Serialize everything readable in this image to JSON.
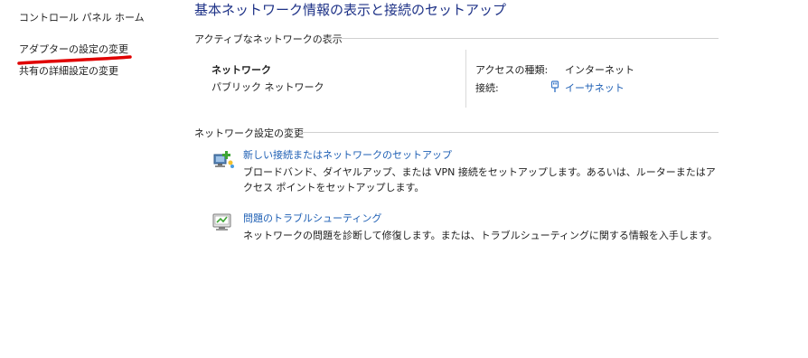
{
  "sidebar": {
    "items": [
      {
        "label": "コントロール パネル ホーム"
      },
      {
        "label": "アダプターの設定の変更"
      },
      {
        "label": "共有の詳細設定の変更"
      }
    ],
    "highlight_color": "#e00000"
  },
  "main": {
    "title": "基本ネットワーク情報の表示と接続のセットアップ",
    "active_networks": {
      "section_label": "アクティブなネットワークの表示",
      "network_name": "ネットワーク",
      "network_type": "パブリック ネットワーク",
      "access_type_label": "アクセスの種類:",
      "access_type_value": "インターネット",
      "connection_label": "接続:",
      "connection_value": "イーサネット",
      "connection_icon": "ethernet-icon"
    },
    "change_settings": {
      "section_label": "ネットワーク設定の変更",
      "tasks": [
        {
          "icon": "new-connection-icon",
          "link": "新しい接続またはネットワークのセットアップ",
          "description": "ブロードバンド、ダイヤルアップ、または VPN 接続をセットアップします。あるいは、ルーターまたはアクセス ポイントをセットアップします。"
        },
        {
          "icon": "troubleshoot-icon",
          "link": "問題のトラブルシューティング",
          "description": "ネットワークの問題を診断して修復します。または、トラブルシューティングに関する情報を入手します。"
        }
      ]
    }
  },
  "colors": {
    "link": "#1e5fb4",
    "title": "#1e3287",
    "annotation": "#e00000"
  }
}
